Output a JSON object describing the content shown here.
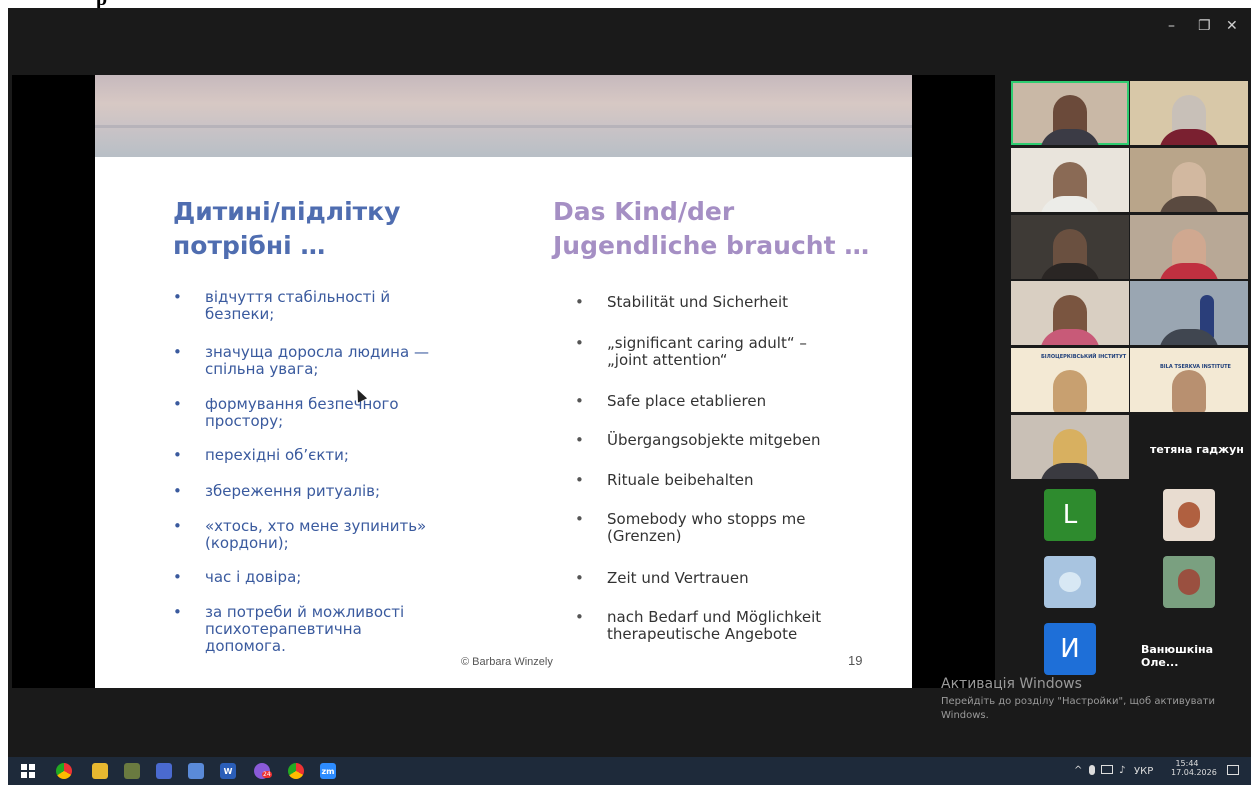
{
  "top_text": "p",
  "window_controls": {
    "minimize": "–",
    "restore": "❐",
    "close": "✕"
  },
  "slide": {
    "title_uk": "Дитині/підлітку\nпотрібні …",
    "title_de": "Das Kind/der\nJugendliche braucht …",
    "items_uk": [
      "відчуття стабільності й\nбезпеки;",
      "значуща доросла людина —\nспільна увага;",
      "формування безпечного\nпростору;",
      "перехідні об’єкти;",
      "збереження ритуалів;",
      "«хтось, хто мене зупинить»\n(кордони);",
      "час і довіра;",
      "за потреби й можливості\nпсихотерапевтична\nдопомога."
    ],
    "items_de": [
      "Stabilität und Sicherheit",
      "„significant caring adult“ –\n„joint attention“",
      "Safe place etablieren",
      "Übergangsobjekte mitgeben",
      "Rituale beibehalten",
      "Somebody who stopps me\n(Grenzen)",
      "Zeit und Vertrauen",
      "nach Bedarf und Möglichkeit\ntherapeutische Angebote"
    ],
    "copyright": "© Barbara Winzely",
    "page_number": "19"
  },
  "participants": {
    "name_tile_1": "тетяна гаджун",
    "name_tile_2": "Ванюшкіна Оле...",
    "avatar_l": "L",
    "avatar_i": "И",
    "banner_text_1": "БІЛОЦЕРКІВСЬКИЙ ІНСТИТУТ",
    "banner_text_2": "BILA TSERKVA INSTITUTE"
  },
  "watermark": {
    "title": "Активація Windows",
    "line": "Перейдіть до розділу \"Настройки\", щоб активувати Windows."
  },
  "taskbar": {
    "language": "УКР",
    "time": "15:44",
    "date": "17.04.2026",
    "zoom_label": "zm",
    "notification_count": "24"
  },
  "colors": {
    "active_speaker": "#2ecc71",
    "title_uk": "#4f6db0",
    "title_de": "#a58fc4",
    "taskbar": "#1e2a3a"
  }
}
